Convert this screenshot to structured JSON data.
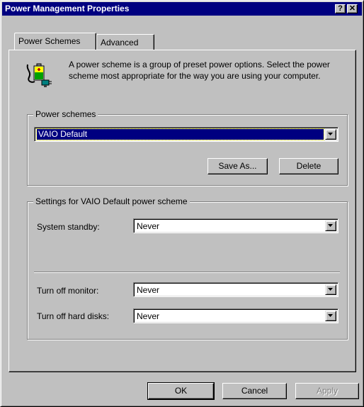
{
  "window": {
    "title": "Power Management Properties",
    "help_glyph": "?",
    "close_glyph": "✕"
  },
  "tabs": [
    {
      "label": "Power Schemes",
      "active": true
    },
    {
      "label": "Advanced",
      "active": false
    }
  ],
  "description": {
    "icon": "power-scheme-icon",
    "text": "A power scheme is a group of preset power options. Select the power scheme most appropriate for the way you are using your computer."
  },
  "power_schemes": {
    "legend": "Power schemes",
    "selected": "VAIO Default",
    "save_as_label": "Save As...",
    "delete_label": "Delete"
  },
  "settings": {
    "legend": "Settings for VAIO Default power scheme",
    "rows": [
      {
        "label": "System standby:",
        "value": "Never"
      },
      {
        "label": "Turn off monitor:",
        "value": "Never"
      },
      {
        "label": "Turn off hard disks:",
        "value": "Never"
      }
    ]
  },
  "footer": {
    "ok_label": "OK",
    "cancel_label": "Cancel",
    "apply_label": "Apply",
    "apply_disabled": true
  },
  "colors": {
    "face": "#c0c0c0",
    "titlebar": "#000080",
    "selection": "#000080"
  }
}
